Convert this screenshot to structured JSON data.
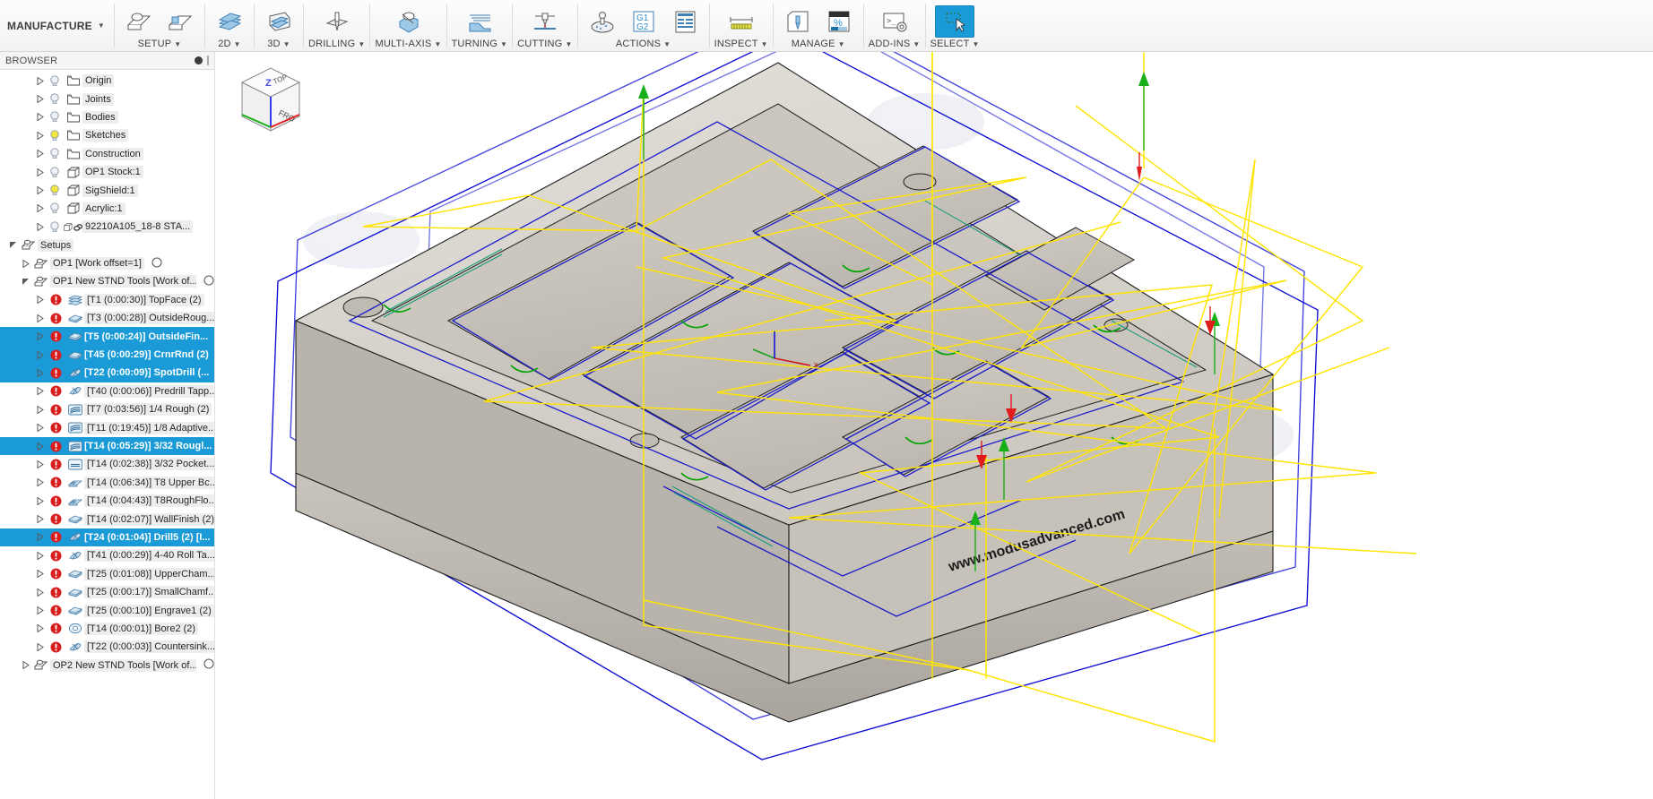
{
  "app": {
    "workspace": "MANUFACTURE"
  },
  "ribbon": {
    "groups": [
      {
        "label": "SETUP",
        "icons": [
          "setup-new-icon",
          "setup-folder-icon"
        ]
      },
      {
        "label": "2D",
        "icons": [
          "milling-2d-icon"
        ]
      },
      {
        "label": "3D",
        "icons": [
          "milling-3d-icon"
        ]
      },
      {
        "label": "DRILLING",
        "icons": [
          "drilling-icon"
        ]
      },
      {
        "label": "MULTI-AXIS",
        "icons": [
          "multi-axis-icon"
        ]
      },
      {
        "label": "TURNING",
        "icons": [
          "turning-icon"
        ]
      },
      {
        "label": "CUTTING",
        "icons": [
          "cutting-icon"
        ]
      },
      {
        "label": "ACTIONS",
        "icons": [
          "simulate-icon",
          "post-process-g1g2-icon",
          "setup-sheet-icon"
        ]
      },
      {
        "label": "INSPECT",
        "icons": [
          "measure-icon"
        ]
      },
      {
        "label": "MANAGE",
        "icons": [
          "tool-library-icon",
          "machining-time-percent-icon"
        ]
      },
      {
        "label": "ADD-INS",
        "icons": [
          "scripts-addins-icon"
        ]
      },
      {
        "label": "SELECT",
        "icons": [
          "select-cursor-icon"
        ],
        "selected": true
      }
    ]
  },
  "browser": {
    "title": "BROWSER",
    "header_icons": [
      "filter-dot-icon",
      "panel-grip-icon"
    ],
    "nodes": [
      {
        "label": "Origin",
        "icon": "folder-icon",
        "bulb": "off",
        "indent": 2
      },
      {
        "label": "Joints",
        "icon": "folder-icon",
        "bulb": "off",
        "indent": 2
      },
      {
        "label": "Bodies",
        "icon": "folder-icon",
        "bulb": "off",
        "indent": 2
      },
      {
        "label": "Sketches",
        "icon": "folder-icon",
        "bulb": "on",
        "indent": 2
      },
      {
        "label": "Construction",
        "icon": "folder-icon",
        "bulb": "off",
        "indent": 2
      },
      {
        "label": "OP1 Stock:1",
        "icon": "body-icon",
        "bulb": "off",
        "indent": 2
      },
      {
        "label": "SigShield:1",
        "icon": "body-icon",
        "bulb": "on",
        "indent": 2
      },
      {
        "label": "Acrylic:1",
        "icon": "body-icon",
        "bulb": "off",
        "indent": 2
      },
      {
        "label": "92210A105_18-8 STA...",
        "icon": "body-link-icon",
        "bulb": "off",
        "indent": 2,
        "link": true
      }
    ],
    "setups_label": "Setups",
    "setups": [
      {
        "label": "OP1  [Work offset=1]",
        "icon": "setup-icon",
        "indent": 1,
        "expanded": false,
        "circle": true
      },
      {
        "label": "OP1 New STND Tools [Work of...",
        "icon": "setup-icon",
        "indent": 1,
        "expanded": true,
        "circle": true
      }
    ],
    "operations": [
      {
        "label": "[T1 (0:00:30)] TopFace (2)",
        "icon": "face-icon",
        "selected": false
      },
      {
        "label": "[T3 (0:00:28)] OutsideRoug...",
        "icon": "contour-icon",
        "selected": false
      },
      {
        "label": "[T5 (0:00:24)] OutsideFin...",
        "icon": "contour-icon",
        "selected": true
      },
      {
        "label": "[T45 (0:00:29)] CrnrRnd (2)",
        "icon": "contour-icon",
        "selected": true
      },
      {
        "label": "[T22 (0:00:09)] SpotDrill (...",
        "icon": "drill-icon",
        "selected": true
      },
      {
        "label": "[T40 (0:00:06)] Predrill Tapp...",
        "icon": "drill-icon",
        "selected": false
      },
      {
        "label": "[T7 (0:03:56)] 1/4 Rough (2)",
        "icon": "adaptive-icon",
        "selected": false
      },
      {
        "label": "[T11 (0:19:45)] 1/8 Adaptive...",
        "icon": "adaptive-icon",
        "selected": false
      },
      {
        "label": "[T14 (0:05:29)] 3/32 Rougl...",
        "icon": "adaptive-icon",
        "selected": true
      },
      {
        "label": "[T14 (0:02:38)] 3/32 Pocket...",
        "icon": "pocket-icon",
        "selected": false
      },
      {
        "label": "[T14 (0:06:34)] T8 Upper Bc...",
        "icon": "parallel-icon",
        "selected": false
      },
      {
        "label": "[T14 (0:04:43)] T8RoughFlo...",
        "icon": "parallel-icon",
        "selected": false
      },
      {
        "label": "[T14 (0:02:07)] WallFinish (2)",
        "icon": "contour-icon",
        "selected": false
      },
      {
        "label": "[T24 (0:01:04)] Drill5 (2) [I...",
        "icon": "drill-icon",
        "selected": true
      },
      {
        "label": "[T41 (0:00:29)] 4-40 Roll Ta...",
        "icon": "drill-icon",
        "selected": false
      },
      {
        "label": "[T25 (0:01:08)] UpperCham...",
        "icon": "contour-icon",
        "selected": false
      },
      {
        "label": "[T25 (0:00:17)] SmallChamf...",
        "icon": "contour-icon",
        "selected": false
      },
      {
        "label": "[T25 (0:00:10)] Engrave1 (2)",
        "icon": "contour-icon",
        "selected": false
      },
      {
        "label": "[T14 (0:00:01)] Bore2 (2)",
        "icon": "bore-icon",
        "selected": false
      },
      {
        "label": "[T22 (0:00:03)] Countersink...",
        "icon": "drill-icon",
        "selected": false
      }
    ],
    "setup_footer": {
      "label": "OP2 New STND Tools [Work of...",
      "icon": "setup-icon",
      "circle": true
    }
  },
  "viewcube": {
    "top_label": "TOP",
    "front_label": "FRO",
    "axis_label": "Z"
  },
  "model": {
    "engraved_text": "www.modusadvanced.com"
  },
  "colors": {
    "accent_select": "#1a9ad6",
    "toolpath_rapid": "#ffe400",
    "stock_outline": "#0000d2",
    "error_badge": "#d81e1e",
    "lead_green": "#00a400",
    "lead_red": "#e01b1b",
    "part_fill": "#d7d3cb"
  }
}
